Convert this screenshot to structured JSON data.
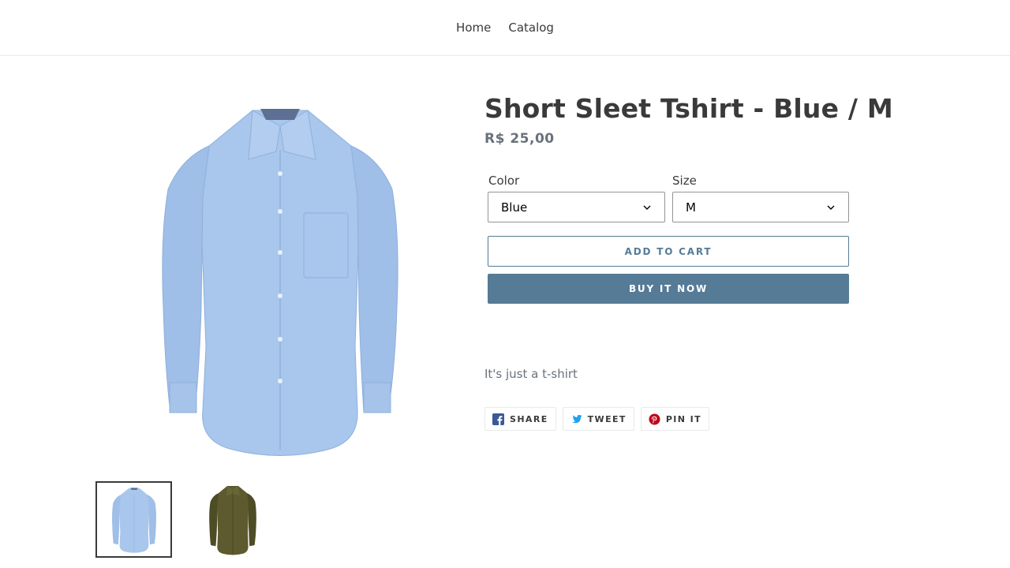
{
  "nav": {
    "items": [
      {
        "label": "Home"
      },
      {
        "label": "Catalog"
      }
    ]
  },
  "product": {
    "title": "Short Sleet Tshirt - Blue / M",
    "price": "R$ 25,00",
    "description": "It's just a t-shirt",
    "options": {
      "color": {
        "label": "Color",
        "value": "Blue"
      },
      "size": {
        "label": "Size",
        "value": "M"
      }
    }
  },
  "buttons": {
    "add_to_cart": "ADD TO CART",
    "buy_now": "BUY IT NOW"
  },
  "share": [
    {
      "label": "SHARE",
      "icon": "facebook-icon"
    },
    {
      "label": "TWEET",
      "icon": "twitter-icon"
    },
    {
      "label": "PIN IT",
      "icon": "pinterest-icon"
    }
  ],
  "thumbnails": [
    {
      "alt": "blue-shirt",
      "active": true
    },
    {
      "alt": "olive-shirt",
      "active": false
    }
  ],
  "colors": {
    "accent": "#557b97",
    "text": "#3a3a3a",
    "muted": "#69727b",
    "shirt_blue": "#a9c6ec",
    "shirt_olive": "#5c5a2e"
  }
}
